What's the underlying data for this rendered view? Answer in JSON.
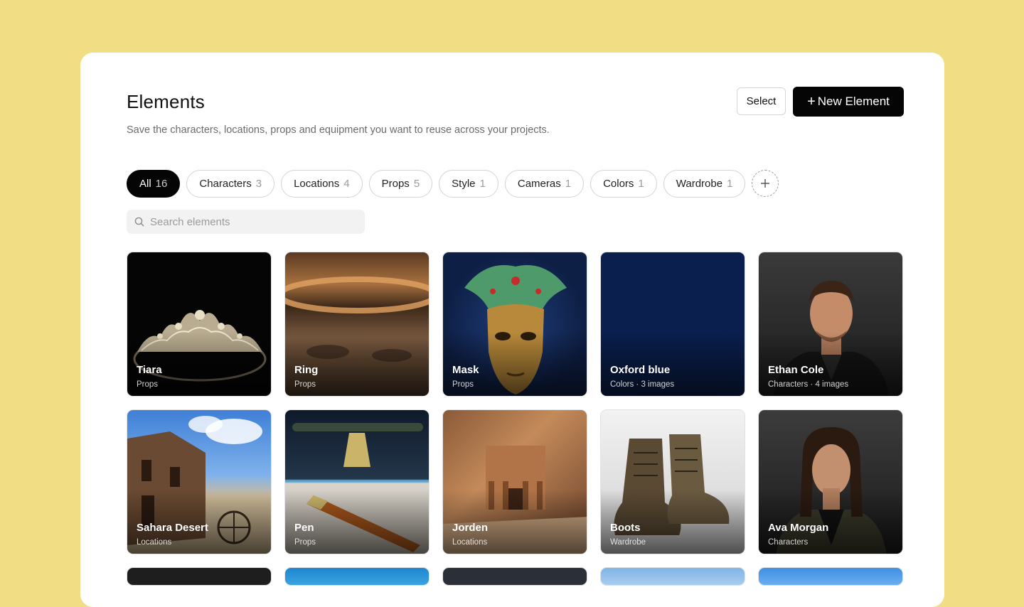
{
  "header": {
    "title": "Elements",
    "subtitle": "Save the characters, locations, props and equipment you want to reuse across your projects.",
    "select_label": "Select",
    "new_plus": "+",
    "new_label": "New Element"
  },
  "filters": [
    {
      "label": "All",
      "count": "16",
      "active": true
    },
    {
      "label": "Characters",
      "count": "3"
    },
    {
      "label": "Locations",
      "count": "4"
    },
    {
      "label": "Props",
      "count": "5"
    },
    {
      "label": "Style",
      "count": "1"
    },
    {
      "label": "Cameras",
      "count": "1"
    },
    {
      "label": "Colors",
      "count": "1"
    },
    {
      "label": "Wardrobe",
      "count": "1"
    }
  ],
  "add_filter_icon": "plus-icon",
  "search": {
    "placeholder": "Search elements",
    "icon": "search-icon"
  },
  "cards": [
    {
      "name": "Tiara",
      "meta": "Props"
    },
    {
      "name": "Ring",
      "meta": "Props"
    },
    {
      "name": "Mask",
      "meta": "Props"
    },
    {
      "name": "Oxford blue",
      "meta": "Colors · 3 images"
    },
    {
      "name": "Ethan Cole",
      "meta": "Characters · 4 images"
    },
    {
      "name": "Sahara Desert",
      "meta": "Locations"
    },
    {
      "name": "Pen",
      "meta": "Props"
    },
    {
      "name": "Jorden",
      "meta": "Locations"
    },
    {
      "name": "Boots",
      "meta": "Wardrobe"
    },
    {
      "name": "Ava Morgan",
      "meta": "Characters"
    }
  ],
  "colors": {
    "background": "#f0dd84",
    "accent": "#050505",
    "oxford_blue": "#0a1f4d"
  }
}
